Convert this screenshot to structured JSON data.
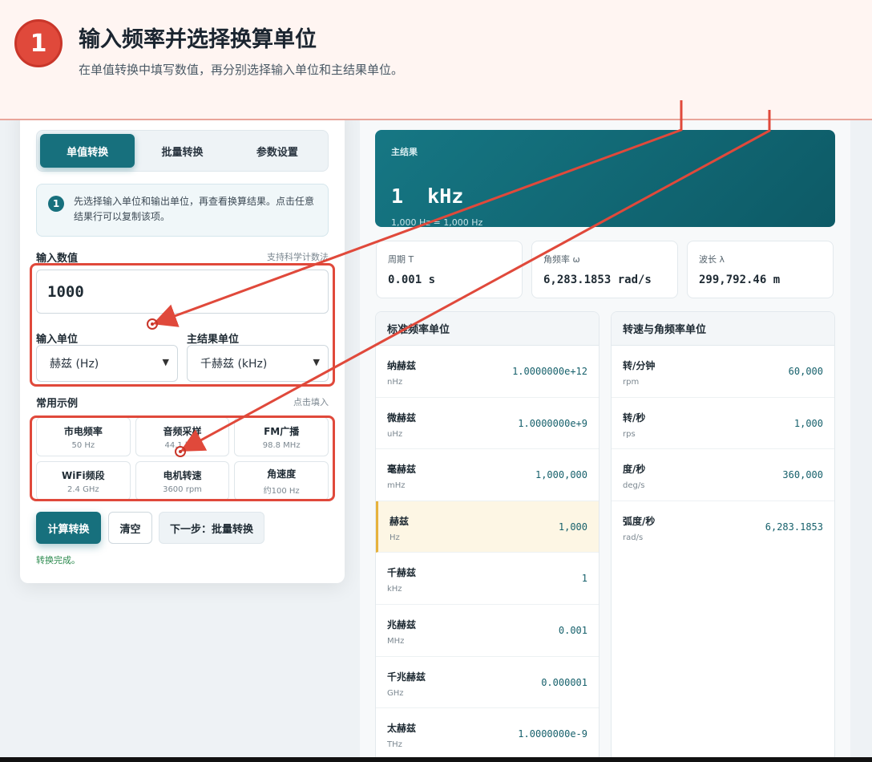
{
  "banner": {
    "step": "1",
    "title": "输入频率并选择换算单位",
    "description": "在单值转换中填写数值，再分别选择输入单位和主结果单位。"
  },
  "tabs": [
    "单值转换",
    "批量转换",
    "参数设置"
  ],
  "hint": {
    "number": "1",
    "text": "先选择输入单位和输出单位，再查看换算结果。点击任意结果行可以复制该项。"
  },
  "input": {
    "label": "输入数值",
    "note": "支持科学计数法",
    "value": "1000",
    "unit_label": "输入单位",
    "unit_value": "赫兹 (Hz)",
    "result_unit_label": "主结果单位",
    "result_unit_value": "千赫兹 (kHz)"
  },
  "examples": {
    "label": "常用示例",
    "note": "点击填入",
    "items": [
      {
        "title": "市电频率",
        "sub": "50 Hz"
      },
      {
        "title": "音频采样",
        "sub": "44.1 kHz"
      },
      {
        "title": "FM广播",
        "sub": "98.8 MHz"
      },
      {
        "title": "WiFi频段",
        "sub": "2.4 GHz"
      },
      {
        "title": "电机转速",
        "sub": "3600 rpm"
      },
      {
        "title": "角速度",
        "sub": "约100 Hz"
      }
    ]
  },
  "buttons": {
    "calc": "计算转换",
    "clear": "清空",
    "next": "下一步：批量转换"
  },
  "status": "转换完成。",
  "main_result": {
    "label": "主结果",
    "value": "1  kHz",
    "sub": "1,000 Hz = 1,000 Hz"
  },
  "stats": [
    {
      "label": "周期 T",
      "value": "0.001 s"
    },
    {
      "label": "角频率 ω",
      "value": "6,283.1853 rad/s"
    },
    {
      "label": "波长 λ",
      "value": "299,792.46 m"
    }
  ],
  "standard_table": {
    "title": "标准频率单位",
    "rows": [
      {
        "name": "纳赫兹",
        "unit": "nHz",
        "value": "1.0000000e+12"
      },
      {
        "name": "微赫兹",
        "unit": "uHz",
        "value": "1.0000000e+9"
      },
      {
        "name": "毫赫兹",
        "unit": "mHz",
        "value": "1,000,000"
      },
      {
        "name": "赫兹",
        "unit": "Hz",
        "value": "1,000"
      },
      {
        "name": "千赫兹",
        "unit": "kHz",
        "value": "1"
      },
      {
        "name": "兆赫兹",
        "unit": "MHz",
        "value": "0.001"
      },
      {
        "name": "千兆赫兹",
        "unit": "GHz",
        "value": "0.000001"
      },
      {
        "name": "太赫兹",
        "unit": "THz",
        "value": "1.0000000e-9"
      }
    ]
  },
  "speed_table": {
    "title": "转速与角频率单位",
    "rows": [
      {
        "name": "转/分钟",
        "unit": "rpm",
        "value": "60,000"
      },
      {
        "name": "转/秒",
        "unit": "rps",
        "value": "1,000"
      },
      {
        "name": "度/秒",
        "unit": "deg/s",
        "value": "360,000"
      },
      {
        "name": "弧度/秒",
        "unit": "rad/s",
        "value": "6,283.1853"
      }
    ]
  },
  "colors": {
    "accent": "#17707d",
    "annotation": "#e0493b",
    "highlight": "#fdf6e4"
  }
}
